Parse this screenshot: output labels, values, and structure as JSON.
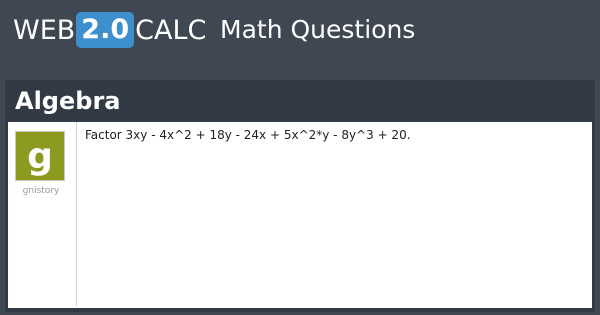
{
  "header": {
    "logo_web": "WEB",
    "logo_version": "2.0",
    "logo_calc": "CALC",
    "title": "Math Questions"
  },
  "section": {
    "title": "Algebra"
  },
  "post": {
    "avatar_letter": "g",
    "username": "gnistory",
    "question": "Factor 3xy - 4x^2 + 18y - 24x + 5x^2*y - 8y^3 + 20."
  },
  "colors": {
    "header_bg": "#3f4752",
    "panel_bg": "#313a45",
    "logo_accent": "#3d8fce",
    "avatar_bg": "#8c9a1f"
  }
}
